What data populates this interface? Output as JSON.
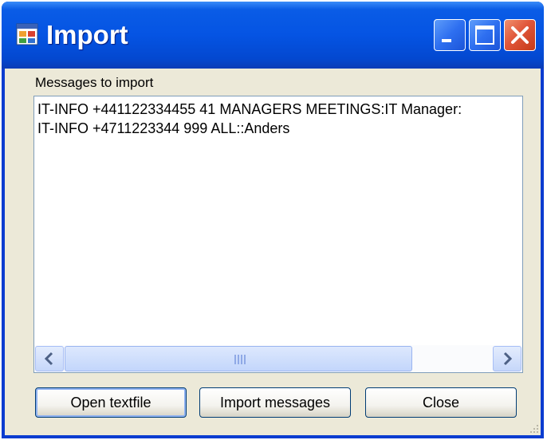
{
  "window": {
    "title": "Import"
  },
  "form": {
    "messages_label": "Messages to import",
    "messages": [
      "IT-INFO +441122334455 41 MANAGERS MEETINGS:IT Manager:",
      "IT-INFO +4711223344 999 ALL::Anders"
    ]
  },
  "buttons": {
    "open": "Open textfile",
    "import": "Import messages",
    "close": "Close"
  },
  "icons": {
    "app": "app-window-icon",
    "minimize": "minimize-icon",
    "maximize": "maximize-icon",
    "close": "close-icon",
    "scroll_left": "chevron-left-icon",
    "scroll_right": "chevron-right-icon"
  },
  "colors": {
    "titlebar": "#0554e3",
    "client_bg": "#ece9d8",
    "close_button": "#e0563a",
    "list_border": "#7f9db9"
  }
}
